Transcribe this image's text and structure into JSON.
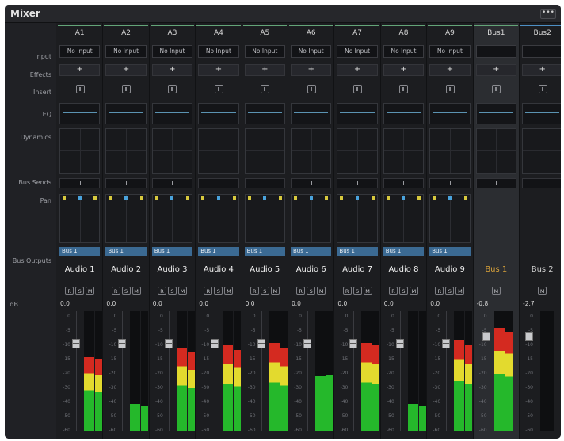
{
  "window": {
    "title": "Mixer",
    "menu_icon": "ellipsis-icon",
    "menu_label": "•••"
  },
  "row_labels": {
    "input": "Input",
    "effects": "Effects",
    "insert": "Insert",
    "eq": "EQ",
    "dynamics": "Dynamics",
    "bus_sends": "Bus Sends",
    "pan": "Pan",
    "bus_outputs": "Bus Outputs",
    "db": "dB"
  },
  "strips": [
    {
      "name": "A1",
      "input": "No Input",
      "effects": "+",
      "bus_output": "Bus 1",
      "channel": "Audio 1",
      "db": "0.0",
      "buttons": [
        "R",
        "S",
        "M"
      ],
      "meter_level": 0.62,
      "meter_level_b": 0.6
    },
    {
      "name": "A2",
      "input": "No Input",
      "effects": "+",
      "bus_output": "Bus 1",
      "channel": "Audio 2",
      "db": "0.0",
      "buttons": [
        "R",
        "S",
        "M"
      ],
      "meter_level": 0.23,
      "meter_level_b": 0.21
    },
    {
      "name": "A3",
      "input": "No Input",
      "effects": "+",
      "bus_output": "Bus 1",
      "channel": "Audio 3",
      "db": "0.0",
      "buttons": [
        "R",
        "S",
        "M"
      ],
      "meter_level": 0.7,
      "meter_level_b": 0.66
    },
    {
      "name": "A4",
      "input": "No Input",
      "effects": "+",
      "bus_output": "Bus 1",
      "channel": "Audio 4",
      "db": "0.0",
      "buttons": [
        "R",
        "S",
        "M"
      ],
      "meter_level": 0.72,
      "meter_level_b": 0.68
    },
    {
      "name": "A5",
      "input": "No Input",
      "effects": "+",
      "bus_output": "Bus 1",
      "channel": "Audio 5",
      "db": "0.0",
      "buttons": [
        "R",
        "S",
        "M"
      ],
      "meter_level": 0.74,
      "meter_level_b": 0.7
    },
    {
      "name": "A6",
      "input": "No Input",
      "effects": "+",
      "bus_output": "Bus 1",
      "channel": "Audio 6",
      "db": "0.0",
      "buttons": [
        "R",
        "S",
        "M"
      ],
      "meter_level": 0.46,
      "meter_level_b": 0.47
    },
    {
      "name": "A7",
      "input": "No Input",
      "effects": "+",
      "bus_output": "Bus 1",
      "channel": "Audio 7",
      "db": "0.0",
      "buttons": [
        "R",
        "S",
        "M"
      ],
      "meter_level": 0.74,
      "meter_level_b": 0.72
    },
    {
      "name": "A8",
      "input": "No Input",
      "effects": "+",
      "bus_output": "Bus 1",
      "channel": "Audio 8",
      "db": "0.0",
      "buttons": [
        "R",
        "S",
        "M"
      ],
      "meter_level": 0.23,
      "meter_level_b": 0.21
    },
    {
      "name": "A9",
      "input": "No Input",
      "effects": "+",
      "bus_output": "Bus 1",
      "channel": "Audio 9",
      "db": "0.0",
      "buttons": [
        "R",
        "S",
        "M"
      ],
      "meter_level": 0.76,
      "meter_level_b": 0.72
    },
    {
      "name": "Bus1",
      "input": "",
      "effects": "+",
      "bus_output": "",
      "channel": "Bus 1",
      "db": "-0.8",
      "buttons": [
        "M"
      ],
      "meter_level": 0.86,
      "meter_level_b": 0.83
    },
    {
      "name": "Bus2",
      "input": "",
      "effects": "+",
      "bus_output": "",
      "channel": "Bus 2",
      "db": "-2.7",
      "buttons": [
        "M"
      ],
      "meter_level": 0,
      "meter_level_b": 0
    }
  ],
  "scale_marks": [
    "0",
    "-5",
    "-10",
    "-15",
    "-20",
    "-30",
    "-40",
    "-50",
    "-60"
  ],
  "colors": {
    "accent_green": "#63a578",
    "meter_green": "#25b82b",
    "meter_yellow": "#e3da2e",
    "meter_red": "#d42a20",
    "bus_output": "#3b6a93",
    "bus_name": "#d8a23a"
  }
}
